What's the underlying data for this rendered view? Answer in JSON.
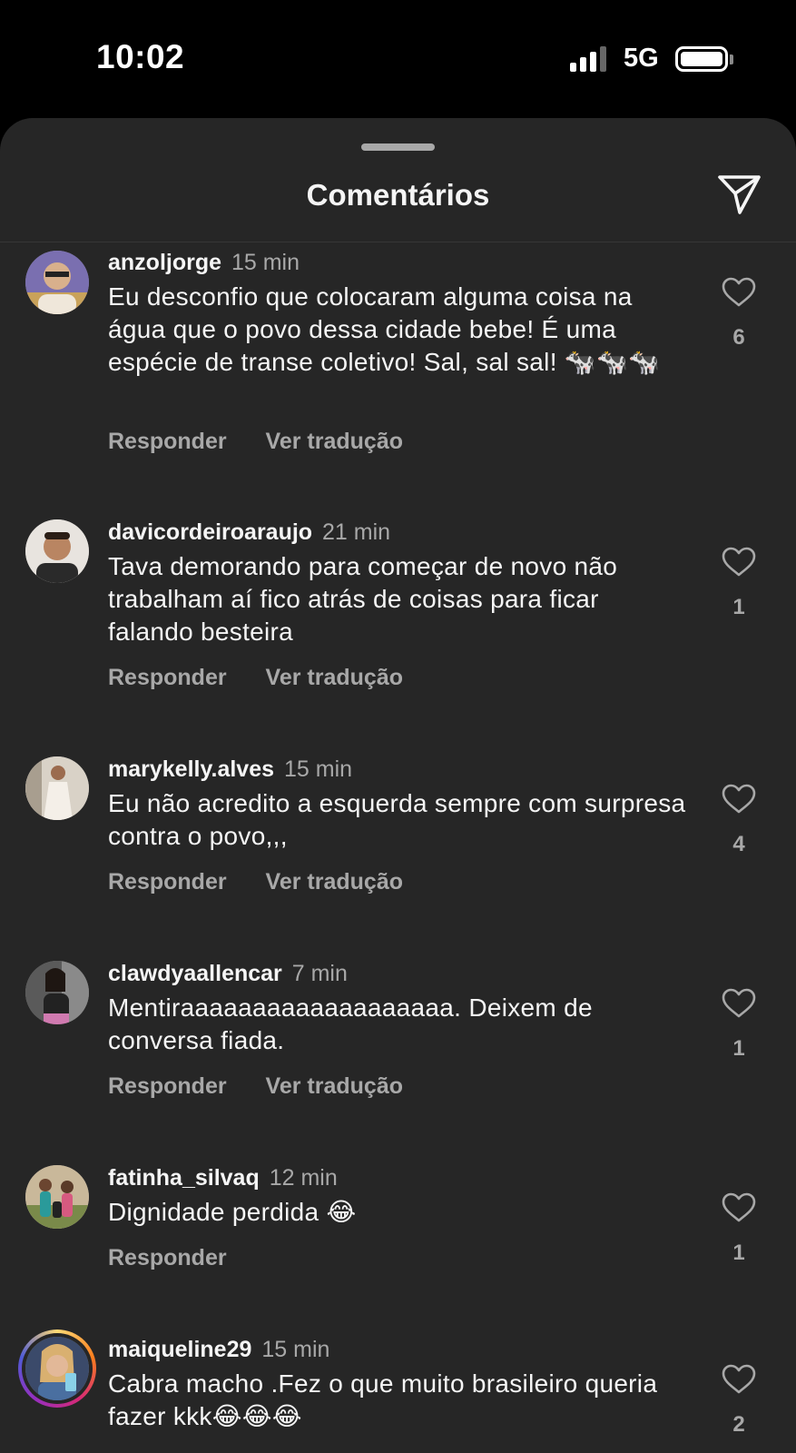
{
  "status_bar": {
    "time": "10:02",
    "network": "5G",
    "battery_icon": "battery-full-icon",
    "signal_icon": "cellular-signal-icon"
  },
  "sheet": {
    "title": "Comentários",
    "share_icon": "paper-plane-icon"
  },
  "comments": [
    {
      "username": "anzoljorge",
      "time": "15 min",
      "text": "Eu desconfio que colocaram alguma coisa na água que o povo dessa cidade bebe! É uma espécie de transe coletivo! Sal, sal sal! 🐄🐄🐄",
      "reply": "Responder",
      "translate": "Ver tradução",
      "likes": "6"
    },
    {
      "username": "davicordeiroaraujo",
      "time": "21 min",
      "text": "Tava demorando para começar de novo não trabalham aí fico atrás de coisas para ficar falando besteira",
      "reply": "Responder",
      "translate": "Ver tradução",
      "likes": "1"
    },
    {
      "username": "marykelly.alves",
      "time": "15 min",
      "text": "Eu não acredito a esquerda sempre com surpresa contra o povo,,,",
      "reply": "Responder",
      "translate": "Ver tradução",
      "likes": "4"
    },
    {
      "username": "clawdyaallencar",
      "time": "7 min",
      "text": "Mentiraaaaaaaaaaaaaaaaaaa. Deixem de conversa fiada.",
      "reply": "Responder",
      "translate": "Ver tradução",
      "likes": "1"
    },
    {
      "username": "fatinha_silvaq",
      "time": "12 min",
      "text": "Dignidade perdida 😂",
      "reply": "Responder",
      "likes": "1"
    },
    {
      "username": "maiqueline29",
      "time": "15 min",
      "text": "Cabra macho .Fez o que muito brasileiro queria fazer kkk😂😂😂",
      "likes": "2"
    }
  ]
}
